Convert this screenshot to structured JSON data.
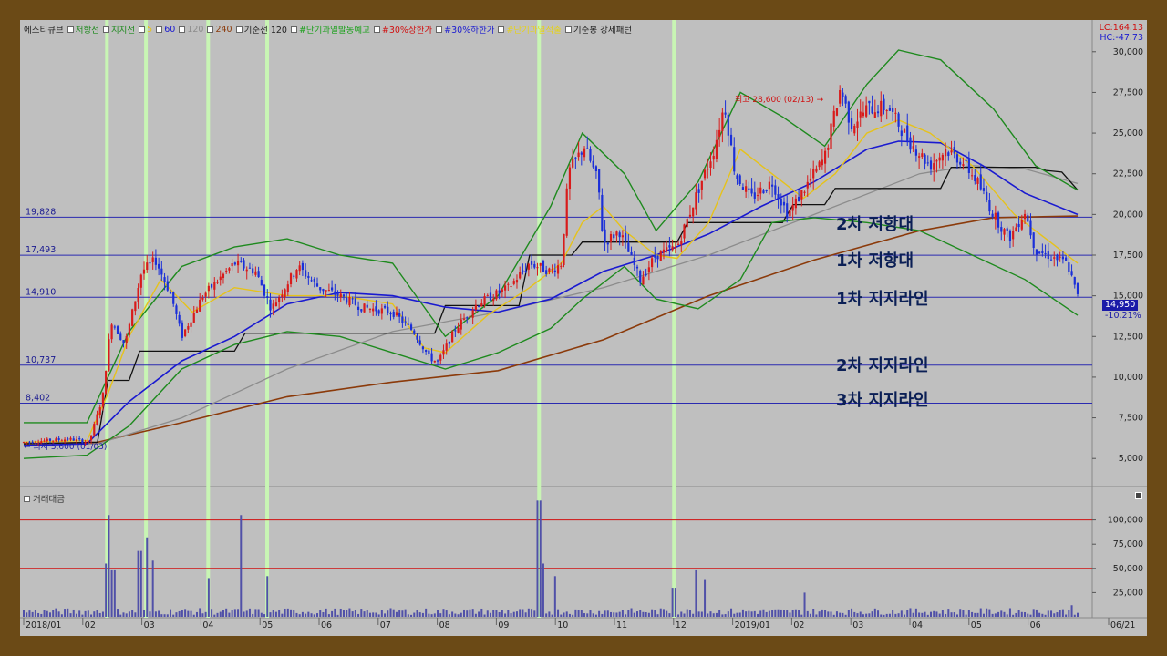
{
  "legend": {
    "items": [
      {
        "label": "에스티큐브",
        "color": "#222222"
      },
      {
        "label": "저항선",
        "color": "#1e8a1e"
      },
      {
        "label": "지지선",
        "color": "#1e8a1e"
      },
      {
        "label": "5",
        "color": "#e6c21a"
      },
      {
        "label": "60",
        "color": "#1a1ad0"
      },
      {
        "label": "120",
        "color": "#8c8c8c"
      },
      {
        "label": "240",
        "color": "#8b3a0a"
      },
      {
        "label": "기준선 120",
        "color": "#222222"
      },
      {
        "label": "#단기과열발동예고",
        "color": "#1aa01a"
      },
      {
        "label": "#30%상한가",
        "color": "#d01010"
      },
      {
        "label": "#30%하한가",
        "color": "#1a1ad0"
      },
      {
        "label": "#단기과열적출",
        "color": "#e6d21a"
      },
      {
        "label": "기준봉 강세패턴",
        "color": "#222222"
      }
    ]
  },
  "lc_hc": {
    "lc": "LC:164.13",
    "hc": "HC:-47.73"
  },
  "price_tag": {
    "value": "14,950",
    "change": "-10.21%"
  },
  "max_label": "최고 28,600 (02/13) →",
  "min_label": "← 최저 5,600 (01/03)",
  "annotations": {
    "r2": "2차 저항대",
    "r1": "1차 저항대",
    "s1": "1차 지지라인",
    "s2": "2차 지지라인",
    "s3": "3차 지지라인"
  },
  "volume_title": "거래대금",
  "chart_data": {
    "type": "candlestick",
    "title": "에스티큐브",
    "y_ticks": [
      "30,000",
      "27,500",
      "25,000",
      "22,500",
      "20,000",
      "17,500",
      "15,000",
      "12,500",
      "10,000",
      "7,500",
      "5,000"
    ],
    "y_tick_values": [
      30000,
      27500,
      25000,
      22500,
      20000,
      17500,
      15000,
      12500,
      10000,
      7500,
      5000
    ],
    "ylim": [
      3500,
      31500
    ],
    "horizontal_lines": [
      {
        "label": "19,828",
        "value": 19828
      },
      {
        "label": "17,493",
        "value": 17493
      },
      {
        "label": "14,910",
        "value": 14910
      },
      {
        "label": "10,737",
        "value": 10737
      },
      {
        "label": "8,402",
        "value": 8402
      }
    ],
    "x_labels": [
      "2018/01",
      "02",
      "03",
      "04",
      "05",
      "06",
      "07",
      "08",
      "09",
      "10",
      "11",
      "12",
      "2019/01",
      "02",
      "03",
      "04",
      "05",
      "06",
      "06/21"
    ],
    "price_path": [
      [
        0,
        6000
      ],
      [
        0.043,
        6200
      ],
      [
        0.062,
        6000
      ],
      [
        0.075,
        8800
      ],
      [
        0.083,
        13500
      ],
      [
        0.096,
        12000
      ],
      [
        0.112,
        16500
      ],
      [
        0.125,
        17200
      ],
      [
        0.14,
        15000
      ],
      [
        0.15,
        12500
      ],
      [
        0.17,
        15000
      ],
      [
        0.2,
        17000
      ],
      [
        0.22,
        16500
      ],
      [
        0.235,
        14200
      ],
      [
        0.26,
        16800
      ],
      [
        0.28,
        15500
      ],
      [
        0.3,
        15000
      ],
      [
        0.32,
        14300
      ],
      [
        0.35,
        14000
      ],
      [
        0.37,
        12800
      ],
      [
        0.385,
        11200
      ],
      [
        0.393,
        10900
      ],
      [
        0.41,
        13000
      ],
      [
        0.43,
        14500
      ],
      [
        0.46,
        15500
      ],
      [
        0.48,
        17000
      ],
      [
        0.5,
        16500
      ],
      [
        0.51,
        17000
      ],
      [
        0.517,
        22600
      ],
      [
        0.532,
        24200
      ],
      [
        0.545,
        22000
      ],
      [
        0.55,
        18200
      ],
      [
        0.565,
        19000
      ],
      [
        0.585,
        16000
      ],
      [
        0.6,
        17500
      ],
      [
        0.62,
        18000
      ],
      [
        0.64,
        21500
      ],
      [
        0.655,
        24000
      ],
      [
        0.665,
        26800
      ],
      [
        0.675,
        22500
      ],
      [
        0.69,
        21000
      ],
      [
        0.71,
        22000
      ],
      [
        0.725,
        20000
      ],
      [
        0.74,
        21500
      ],
      [
        0.76,
        23500
      ],
      [
        0.775,
        27800
      ],
      [
        0.785,
        25500
      ],
      [
        0.8,
        26500
      ],
      [
        0.82,
        26600
      ],
      [
        0.84,
        24500
      ],
      [
        0.86,
        23000
      ],
      [
        0.875,
        24000
      ],
      [
        0.89,
        23300
      ],
      [
        0.905,
        22000
      ],
      [
        0.92,
        20000
      ],
      [
        0.935,
        18500
      ],
      [
        0.95,
        20200
      ],
      [
        0.96,
        17800
      ],
      [
        0.975,
        17400
      ],
      [
        0.99,
        17000
      ],
      [
        1.0,
        14950
      ]
    ],
    "lines": {
      "ma5": {
        "name": "5",
        "points": [
          [
            0,
            6000
          ],
          [
            0.06,
            6100
          ],
          [
            0.08,
            9000
          ],
          [
            0.1,
            12500
          ],
          [
            0.13,
            16000
          ],
          [
            0.16,
            14000
          ],
          [
            0.2,
            15500
          ],
          [
            0.25,
            15000
          ],
          [
            0.3,
            15000
          ],
          [
            0.35,
            14500
          ],
          [
            0.38,
            11800
          ],
          [
            0.4,
            11500
          ],
          [
            0.44,
            13800
          ],
          [
            0.48,
            15500
          ],
          [
            0.51,
            17000
          ],
          [
            0.53,
            19500
          ],
          [
            0.55,
            20500
          ],
          [
            0.57,
            19000
          ],
          [
            0.6,
            17500
          ],
          [
            0.62,
            17300
          ],
          [
            0.65,
            19500
          ],
          [
            0.68,
            24000
          ],
          [
            0.71,
            22500
          ],
          [
            0.74,
            21000
          ],
          [
            0.77,
            22500
          ],
          [
            0.8,
            25000
          ],
          [
            0.83,
            25800
          ],
          [
            0.86,
            25000
          ],
          [
            0.9,
            23000
          ],
          [
            0.94,
            20000
          ],
          [
            0.97,
            18500
          ],
          [
            1.0,
            17000
          ]
        ]
      },
      "ma60": {
        "name": "60",
        "points": [
          [
            0,
            5800
          ],
          [
            0.06,
            5900
          ],
          [
            0.1,
            8500
          ],
          [
            0.15,
            11000
          ],
          [
            0.2,
            12500
          ],
          [
            0.25,
            14500
          ],
          [
            0.3,
            15200
          ],
          [
            0.35,
            15000
          ],
          [
            0.4,
            14300
          ],
          [
            0.45,
            14000
          ],
          [
            0.5,
            14800
          ],
          [
            0.55,
            16500
          ],
          [
            0.6,
            17500
          ],
          [
            0.65,
            18800
          ],
          [
            0.7,
            20500
          ],
          [
            0.75,
            22000
          ],
          [
            0.8,
            24000
          ],
          [
            0.83,
            24500
          ],
          [
            0.87,
            24400
          ],
          [
            0.91,
            23000
          ],
          [
            0.95,
            21300
          ],
          [
            1.0,
            20000
          ]
        ]
      },
      "ma120": {
        "name": "120",
        "points": [
          [
            0,
            5800
          ],
          [
            0.07,
            5900
          ],
          [
            0.15,
            7500
          ],
          [
            0.25,
            10500
          ],
          [
            0.35,
            12800
          ],
          [
            0.45,
            14000
          ],
          [
            0.55,
            15500
          ],
          [
            0.65,
            17500
          ],
          [
            0.75,
            20000
          ],
          [
            0.85,
            22500
          ],
          [
            0.9,
            23000
          ],
          [
            0.95,
            22800
          ],
          [
            1.0,
            21900
          ]
        ]
      },
      "ma240": {
        "name": "240",
        "points": [
          [
            0,
            5900
          ],
          [
            0.07,
            6000
          ],
          [
            0.15,
            7200
          ],
          [
            0.25,
            8800
          ],
          [
            0.35,
            9700
          ],
          [
            0.45,
            10400
          ],
          [
            0.55,
            12300
          ],
          [
            0.65,
            15000
          ],
          [
            0.75,
            17200
          ],
          [
            0.85,
            19000
          ],
          [
            0.92,
            19800
          ],
          [
            1.0,
            19900
          ]
        ]
      },
      "resistance": {
        "name": "저항선",
        "points": [
          [
            0,
            7200
          ],
          [
            0.06,
            7200
          ],
          [
            0.1,
            12800
          ],
          [
            0.15,
            16800
          ],
          [
            0.2,
            18000
          ],
          [
            0.25,
            18500
          ],
          [
            0.3,
            17500
          ],
          [
            0.35,
            17000
          ],
          [
            0.4,
            12500
          ],
          [
            0.45,
            15000
          ],
          [
            0.5,
            20500
          ],
          [
            0.53,
            25000
          ],
          [
            0.57,
            22500
          ],
          [
            0.6,
            19000
          ],
          [
            0.64,
            22000
          ],
          [
            0.68,
            27500
          ],
          [
            0.72,
            26000
          ],
          [
            0.76,
            24200
          ],
          [
            0.8,
            28000
          ],
          [
            0.83,
            30100
          ],
          [
            0.87,
            29500
          ],
          [
            0.92,
            26500
          ],
          [
            0.96,
            23000
          ],
          [
            1.0,
            21500
          ]
        ]
      },
      "support": {
        "name": "지지선",
        "points": [
          [
            0,
            5000
          ],
          [
            0.06,
            5200
          ],
          [
            0.1,
            7000
          ],
          [
            0.15,
            10500
          ],
          [
            0.2,
            12000
          ],
          [
            0.25,
            12800
          ],
          [
            0.3,
            12500
          ],
          [
            0.35,
            11500
          ],
          [
            0.4,
            10500
          ],
          [
            0.45,
            11500
          ],
          [
            0.5,
            13000
          ],
          [
            0.53,
            14800
          ],
          [
            0.57,
            16800
          ],
          [
            0.6,
            14800
          ],
          [
            0.64,
            14200
          ],
          [
            0.68,
            16000
          ],
          [
            0.71,
            19500
          ],
          [
            0.75,
            19800
          ],
          [
            0.8,
            19500
          ],
          [
            0.85,
            19000
          ],
          [
            0.9,
            17500
          ],
          [
            0.95,
            16000
          ],
          [
            1.0,
            13800
          ]
        ]
      },
      "baseline": {
        "name": "기준선 120",
        "points": [
          [
            0,
            5900
          ],
          [
            0.07,
            6000
          ],
          [
            0.08,
            9800
          ],
          [
            0.1,
            9800
          ],
          [
            0.11,
            11600
          ],
          [
            0.2,
            11600
          ],
          [
            0.21,
            12700
          ],
          [
            0.39,
            12700
          ],
          [
            0.4,
            14400
          ],
          [
            0.47,
            14400
          ],
          [
            0.48,
            17500
          ],
          [
            0.52,
            17500
          ],
          [
            0.53,
            18300
          ],
          [
            0.62,
            18300
          ],
          [
            0.63,
            19500
          ],
          [
            0.72,
            19500
          ],
          [
            0.73,
            20600
          ],
          [
            0.76,
            20600
          ],
          [
            0.77,
            21600
          ],
          [
            0.87,
            21600
          ],
          [
            0.88,
            22900
          ],
          [
            0.96,
            22900
          ],
          [
            0.97,
            22700
          ],
          [
            0.985,
            22600
          ],
          [
            1.0,
            21500
          ]
        ]
      }
    },
    "vertical_markers": [
      0.079,
      0.116,
      0.175,
      0.231,
      0.489,
      0.617
    ],
    "volume": {
      "y_ticks": [
        "100,000",
        "75,000",
        "50,000",
        "25,000"
      ],
      "y_tick_values": [
        100000,
        75000,
        50000,
        25000
      ],
      "ylim": [
        0,
        125000
      ],
      "reference_lines": [
        100000,
        50000
      ],
      "spikes": [
        [
          0.079,
          55000
        ],
        [
          0.081,
          105000
        ],
        [
          0.085,
          48000
        ],
        [
          0.11,
          68000
        ],
        [
          0.116,
          82000
        ],
        [
          0.122,
          58000
        ],
        [
          0.175,
          40000
        ],
        [
          0.205,
          105000
        ],
        [
          0.231,
          42000
        ],
        [
          0.489,
          120000
        ],
        [
          0.492,
          55000
        ],
        [
          0.505,
          42000
        ],
        [
          0.617,
          30000
        ],
        [
          0.638,
          48000
        ],
        [
          0.646,
          38000
        ],
        [
          0.74,
          25000
        ],
        [
          0.995,
          12000
        ]
      ]
    }
  }
}
